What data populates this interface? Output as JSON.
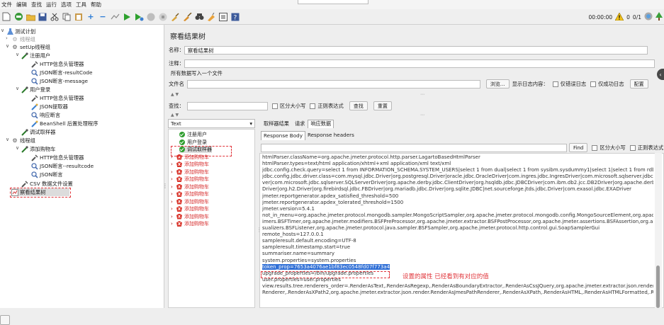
{
  "menu": [
    "文件",
    "编辑",
    "查找",
    "运行",
    "选项",
    "工具",
    "帮助"
  ],
  "toolbar_right": {
    "time": "00:00:00",
    "warn_count": "0",
    "threads": "0/1"
  },
  "tree": {
    "root": "测试计划",
    "thread_group_1": "线程组",
    "setup_group": "setUp线程组",
    "register": "注册用户",
    "http_header_1": "HTTP信息头管理器",
    "json_assert_resultcode": "JSON断言-resultCode",
    "json_assert_message": "JSON断言-message",
    "login": "用户登录",
    "http_header_2": "HTTP信息头管理器",
    "json_extractor": "JSON提取器",
    "response_assert": "响应断言",
    "beanshell": "BeanShell 后置处理程序",
    "debug_sampler": "调试取样器",
    "thread_group_2": "线程组",
    "add_cart": "添加购物车",
    "http_header_3": "HTTP信息头管理器",
    "json_assert_resultcode_2": "JSON断言--resultcode",
    "json_assert_2": "JSON断言",
    "csv": "CSV 数据文件设置",
    "view_results": "察看结果树"
  },
  "panel": {
    "title": "察看结果树",
    "name_label": "名称：",
    "name_value": "察看结果树",
    "comment_label": "注释：",
    "write_all_label": "所有数据写入一个文件",
    "filename_label": "文件名",
    "browse": "浏览...",
    "log_display_label": "显示日志内容：",
    "errors_only": "仅错误日志",
    "success_only": "仅成功日志",
    "configure": "配置",
    "search_label": "查找：",
    "case_sensitive": "区分大小写",
    "regex": "正则表达式",
    "find_btn": "查找",
    "reset_btn": "重置",
    "render_select": "Text",
    "find_btn2": "Find",
    "case_sensitive2": "区分大小写",
    "regex2": "正则表达式"
  },
  "result_list": [
    {
      "label": "注册用户",
      "status": "ok"
    },
    {
      "label": "用户登录",
      "status": "ok"
    },
    {
      "label": "调试取样器",
      "status": "ok"
    },
    {
      "label": "添加购物车",
      "status": "err"
    },
    {
      "label": "添加购物车",
      "status": "err"
    },
    {
      "label": "添加购物车",
      "status": "err"
    },
    {
      "label": "添加购物车",
      "status": "err"
    },
    {
      "label": "添加购物车",
      "status": "err"
    },
    {
      "label": "添加购物车",
      "status": "err"
    },
    {
      "label": "添加购物车",
      "status": "err"
    },
    {
      "label": "添加购物车",
      "status": "err"
    },
    {
      "label": "添加购物车",
      "status": "err"
    },
    {
      "label": "添加购物车",
      "status": "err"
    }
  ],
  "tabs": [
    "取样器结果",
    "请求",
    "响应数据"
  ],
  "subtabs": [
    "Response Body",
    "Response headers"
  ],
  "response_lines": [
    "htmlParser.className=org.apache.jmeter.protocol.http.parser.LagartoBasedHtmlParser",
    "htmlParser.types=text/html application/xhtml+xml application/xml text/xml",
    "jdbc.config.check.query=select 1 from INFORMATION_SCHEMA.SYSTEM_USERS|select 1 from dual|select 1 from sysibm.sysdummy1|select 1|select 1 from rdb$database",
    "jdbc.config.jdbc.driver.class=com.mysql.jdbc.Driver|org.postgresql.Driver|oracle.jdbc.OracleDriver|com.ingres.jdbc.IngresDriver|com.microsoft.sqlserver.jdbc.SQLServerDri",
    "ver|com.microsoft.jdbc.sqlserver.SQLServerDriver|org.apache.derby.jdbc.ClientDriver|org.hsqldb.jdbc.JDBCDriver|com.ibm.db2.jcc.DB2Driver|org.apache.derby.jdbc.Client",
    "Driver|org.h2.Driver|org.firebirdsql.jdbc.FBDriver|org.mariadb.jdbc.Driver|org.sqlite.JDBC|net.sourceforge.jtds.jdbc.Driver|com.exasol.jdbc.EXADriver",
    "jmeter.reportgenerator.apdex_satisfied_threshold=500",
    "jmeter.reportgenerator.apdex_tolerated_threshold=1500",
    "jmeter.version=5.4.1",
    "not_in_menu=org.apache.jmeter.protocol.mongodb.sampler.MongoScriptSampler,org.apache.jmeter.protocol.mongodb.config.MongoSourceElement,org.apache.jmeter.t",
    "imers.BSFTimer,org.apache.jmeter.modifiers.BSFPreProcessor,org.apache.jmeter.extractor.BSFPostProcessor,org.apache.jmeter.assertions.BSFAssertion,org.apache.jmeter.vi",
    "sualizers.BSFListener,org.apache.jmeter.protocol.java.sampler.BSFSampler,org.apache.jmeter.protocol.http.control.gui.SoapSamplerGui",
    "remote_hosts=127.0.0.1",
    "sampleresult.default.encoding=UTF-8",
    "sampleresult.timestamp.start=true",
    "summariser.name=summary",
    "system.properties=system.properties",
    "token_prop=7653a4076ae1bf83ec0548fd07f773a4",
    "upgrade_properties=/bin/upgrade.properties",
    "user.properties=user.properties",
    "view.results.tree.renderers_order=.RenderAsText,.RenderAsRegexp,.RenderAsBoundaryExtractor,.RenderAsCssJQuery,org.apache.jmeter.extractor.json.render.RenderAsJson",
    "Renderer,.RenderAsXPath2,org.apache.jmeter.extractor.json.render.RenderAsJmesPathRenderer,.RenderAsXPath,.RenderAsHTML,.RenderAsHTMLFormatted,.RenderAsHTM"
  ],
  "annotation": "设置的属性 已经看到有对应的值",
  "colors": {
    "error": "#d62a2a",
    "ok": "#2e9d2e",
    "highlight": "#2f6fd6",
    "annotation": "#e0343a"
  }
}
